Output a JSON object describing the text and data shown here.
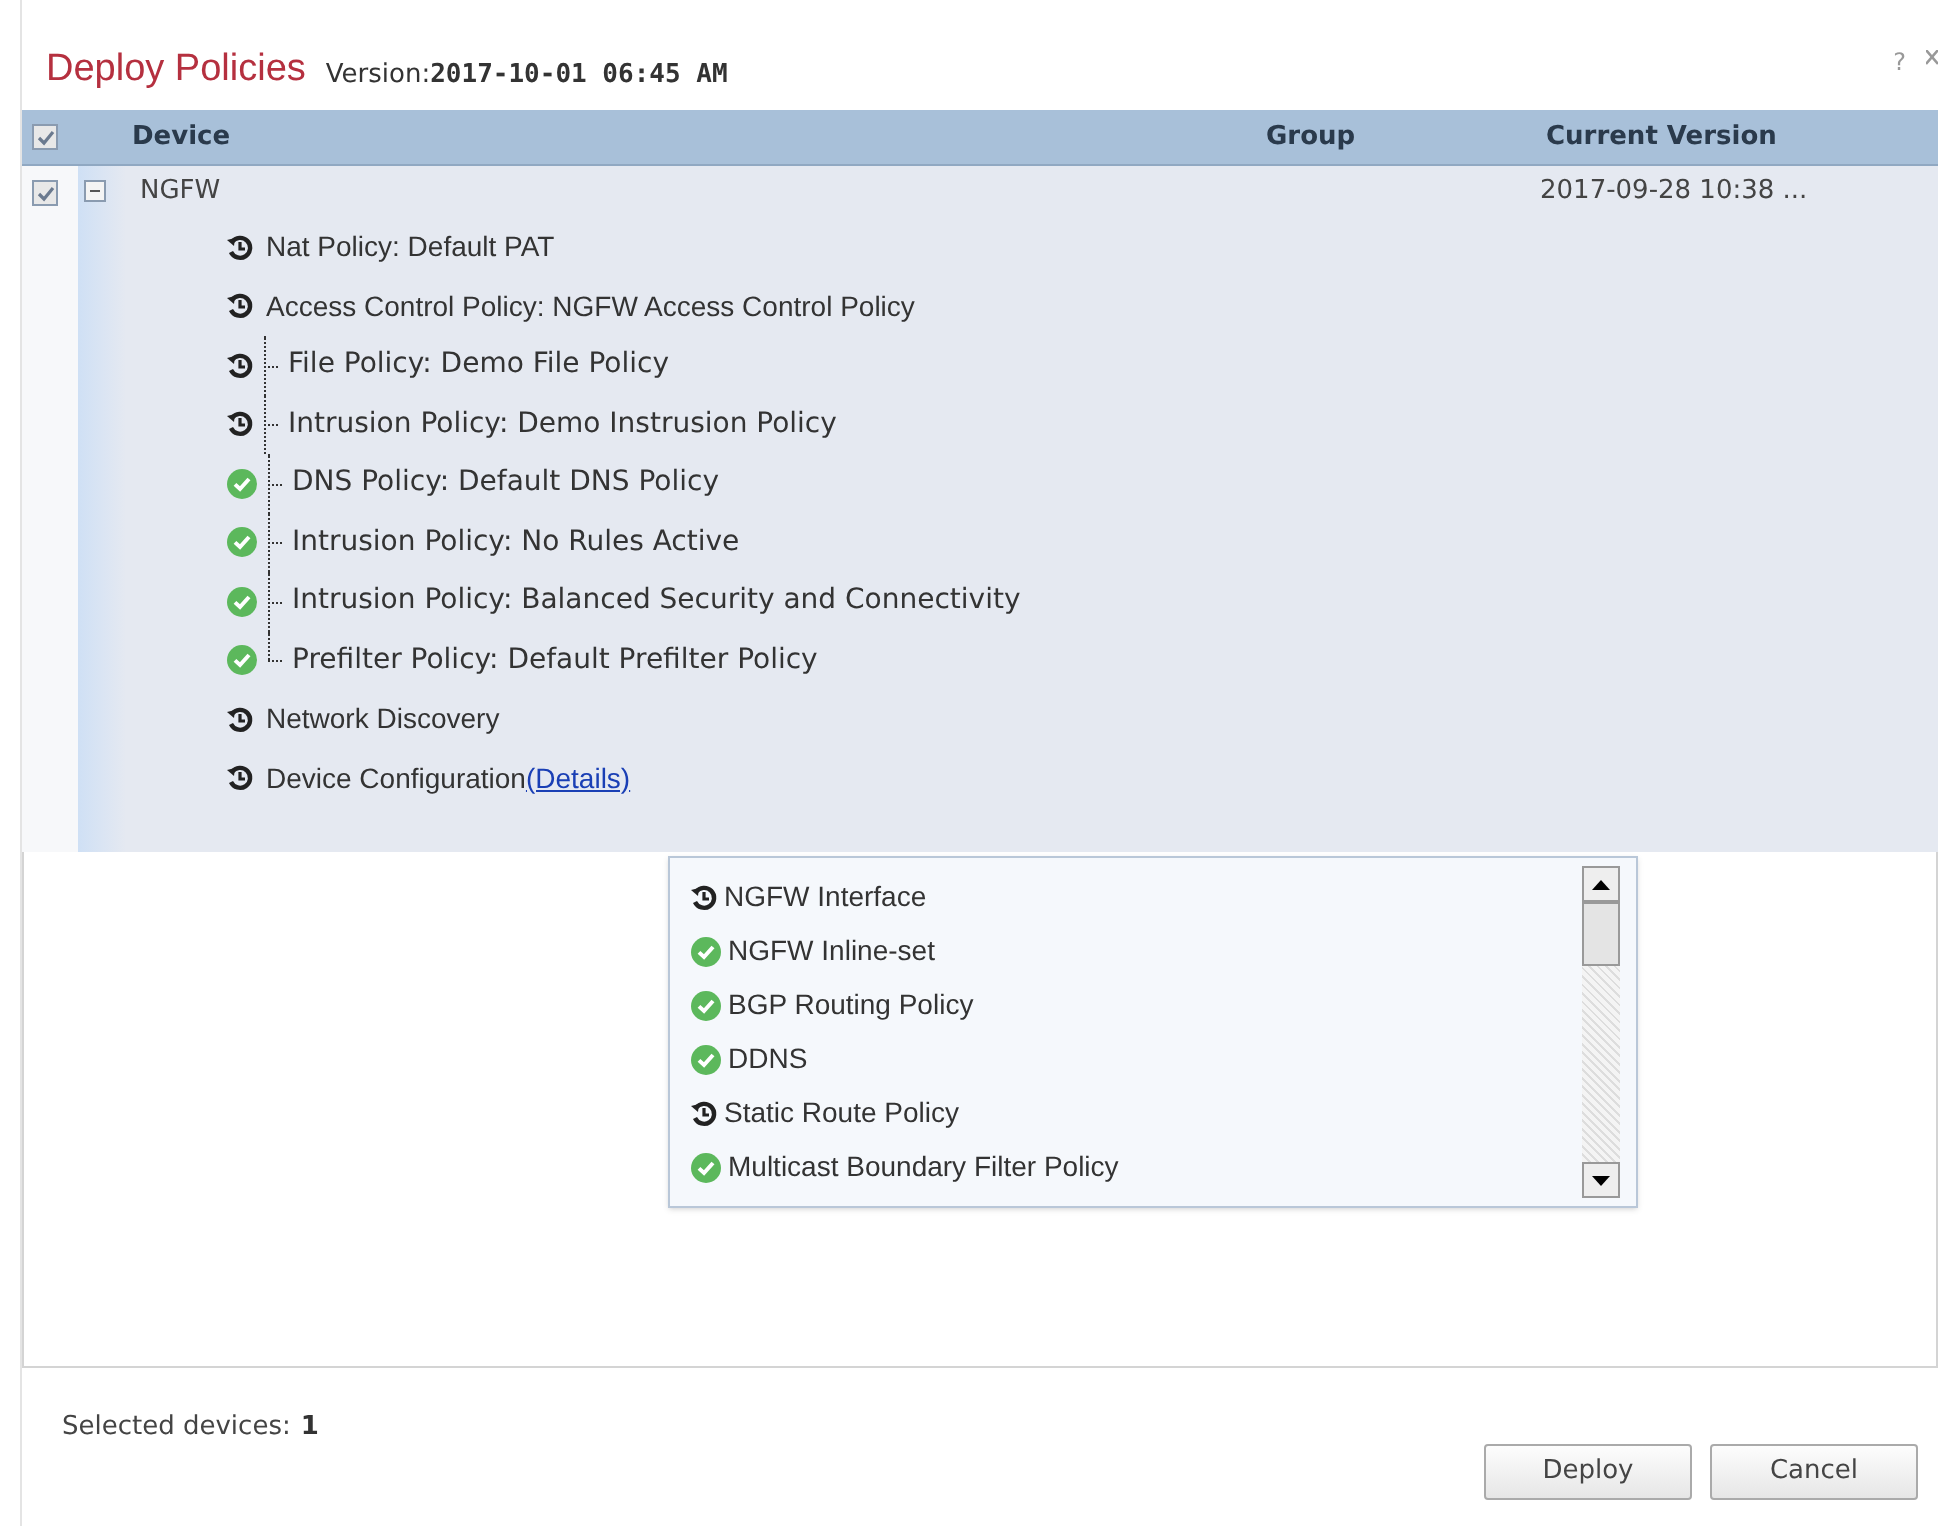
{
  "dialog": {
    "title": "Deploy Policies",
    "version_label": "Version:",
    "version_value": "2017-10-01 06:45 AM",
    "help": "?"
  },
  "table": {
    "header_checked": true,
    "columns": [
      "Device",
      "Group",
      "Current Version"
    ],
    "rows": [
      {
        "checked": true,
        "expanded": true,
        "device": "NGFW",
        "current_version": "2017-09-28 10:38 ...",
        "items": [
          {
            "kind": "pending",
            "label": "Nat Policy: Default PAT"
          },
          {
            "kind": "pending",
            "label": "Access Control Policy: NGFW Access Control Policy",
            "children": [
              {
                "kind": "pending",
                "label": "File Policy: Demo File Policy"
              },
              {
                "kind": "pending",
                "label": "Intrusion Policy: Demo Instrusion Policy"
              },
              {
                "kind": "done",
                "label": "DNS Policy: Default DNS Policy"
              },
              {
                "kind": "done",
                "label": "Intrusion Policy: No Rules Active"
              },
              {
                "kind": "done",
                "label": "Intrusion Policy: Balanced Security and Connectivity"
              },
              {
                "kind": "done",
                "label": "Prefilter Policy: Default Prefilter Policy"
              }
            ]
          },
          {
            "kind": "pending",
            "label": "Network Discovery"
          },
          {
            "kind": "pending",
            "label": "Device Configuration",
            "link": "(Details)"
          }
        ]
      }
    ]
  },
  "details_list": [
    {
      "kind": "pending",
      "label": "NGFW Interface"
    },
    {
      "kind": "done",
      "label": "NGFW Inline-set"
    },
    {
      "kind": "done",
      "label": "BGP Routing Policy"
    },
    {
      "kind": "done",
      "label": "DDNS"
    },
    {
      "kind": "pending",
      "label": "Static Route Policy"
    },
    {
      "kind": "done",
      "label": "Multicast Boundary Filter Policy"
    }
  ],
  "footer": {
    "label": "Selected devices:",
    "count": "1",
    "buttons": [
      "Deploy",
      "Cancel"
    ]
  }
}
